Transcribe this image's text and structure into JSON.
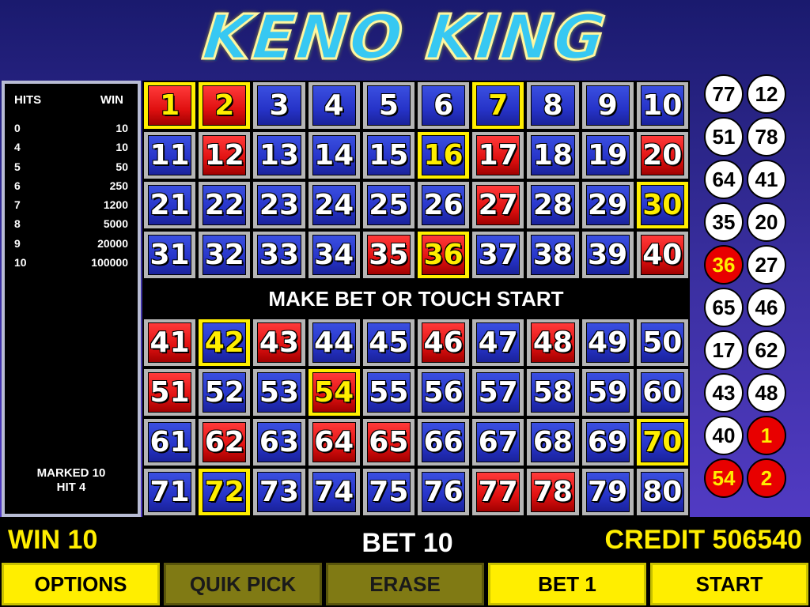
{
  "title": "KENO KING",
  "paytable": {
    "hits_header": "HITS",
    "win_header": "WIN",
    "rows": [
      {
        "hits": "0",
        "win": "10"
      },
      {
        "hits": "4",
        "win": "10"
      },
      {
        "hits": "5",
        "win": "50"
      },
      {
        "hits": "6",
        "win": "250"
      },
      {
        "hits": "7",
        "win": "1200"
      },
      {
        "hits": "8",
        "win": "5000"
      },
      {
        "hits": "9",
        "win": "20000"
      },
      {
        "hits": "10",
        "win": "100000"
      }
    ],
    "marked_text": "MARKED 10",
    "hit_text": "HIT 4"
  },
  "board": {
    "message": "MAKE BET OR TOUCH START",
    "hit_numbers": [
      1,
      2,
      12,
      17,
      20,
      27,
      35,
      36,
      40,
      41,
      43,
      46,
      48,
      51,
      54,
      62,
      64,
      65,
      77,
      78
    ],
    "marked_numbers": [
      1,
      2,
      7,
      16,
      30,
      36,
      42,
      54,
      70,
      72
    ]
  },
  "drawn_balls": [
    {
      "n": "77",
      "style": "white"
    },
    {
      "n": "12",
      "style": "white"
    },
    {
      "n": "51",
      "style": "white"
    },
    {
      "n": "78",
      "style": "white"
    },
    {
      "n": "64",
      "style": "white"
    },
    {
      "n": "41",
      "style": "white"
    },
    {
      "n": "35",
      "style": "white"
    },
    {
      "n": "20",
      "style": "white"
    },
    {
      "n": "36",
      "style": "red"
    },
    {
      "n": "27",
      "style": "white"
    },
    {
      "n": "65",
      "style": "white"
    },
    {
      "n": "46",
      "style": "white"
    },
    {
      "n": "17",
      "style": "white"
    },
    {
      "n": "62",
      "style": "white"
    },
    {
      "n": "43",
      "style": "white"
    },
    {
      "n": "48",
      "style": "white"
    },
    {
      "n": "40",
      "style": "white"
    },
    {
      "n": "1",
      "style": "red"
    },
    {
      "n": "54",
      "style": "red"
    },
    {
      "n": "2",
      "style": "red"
    }
  ],
  "status": {
    "win": "WIN 10",
    "bet": "BET 10",
    "credit": "CREDIT 506540"
  },
  "buttons": {
    "options": "OPTIONS",
    "quik_pick": "QUIK PICK",
    "erase": "ERASE",
    "bet1": "BET 1",
    "start": "START"
  },
  "colors": {
    "hit": "#e01010",
    "unhit": "#2633c8",
    "marked_border": "#ffee00",
    "button": "#ffee00",
    "button_disabled": "#807a14"
  }
}
